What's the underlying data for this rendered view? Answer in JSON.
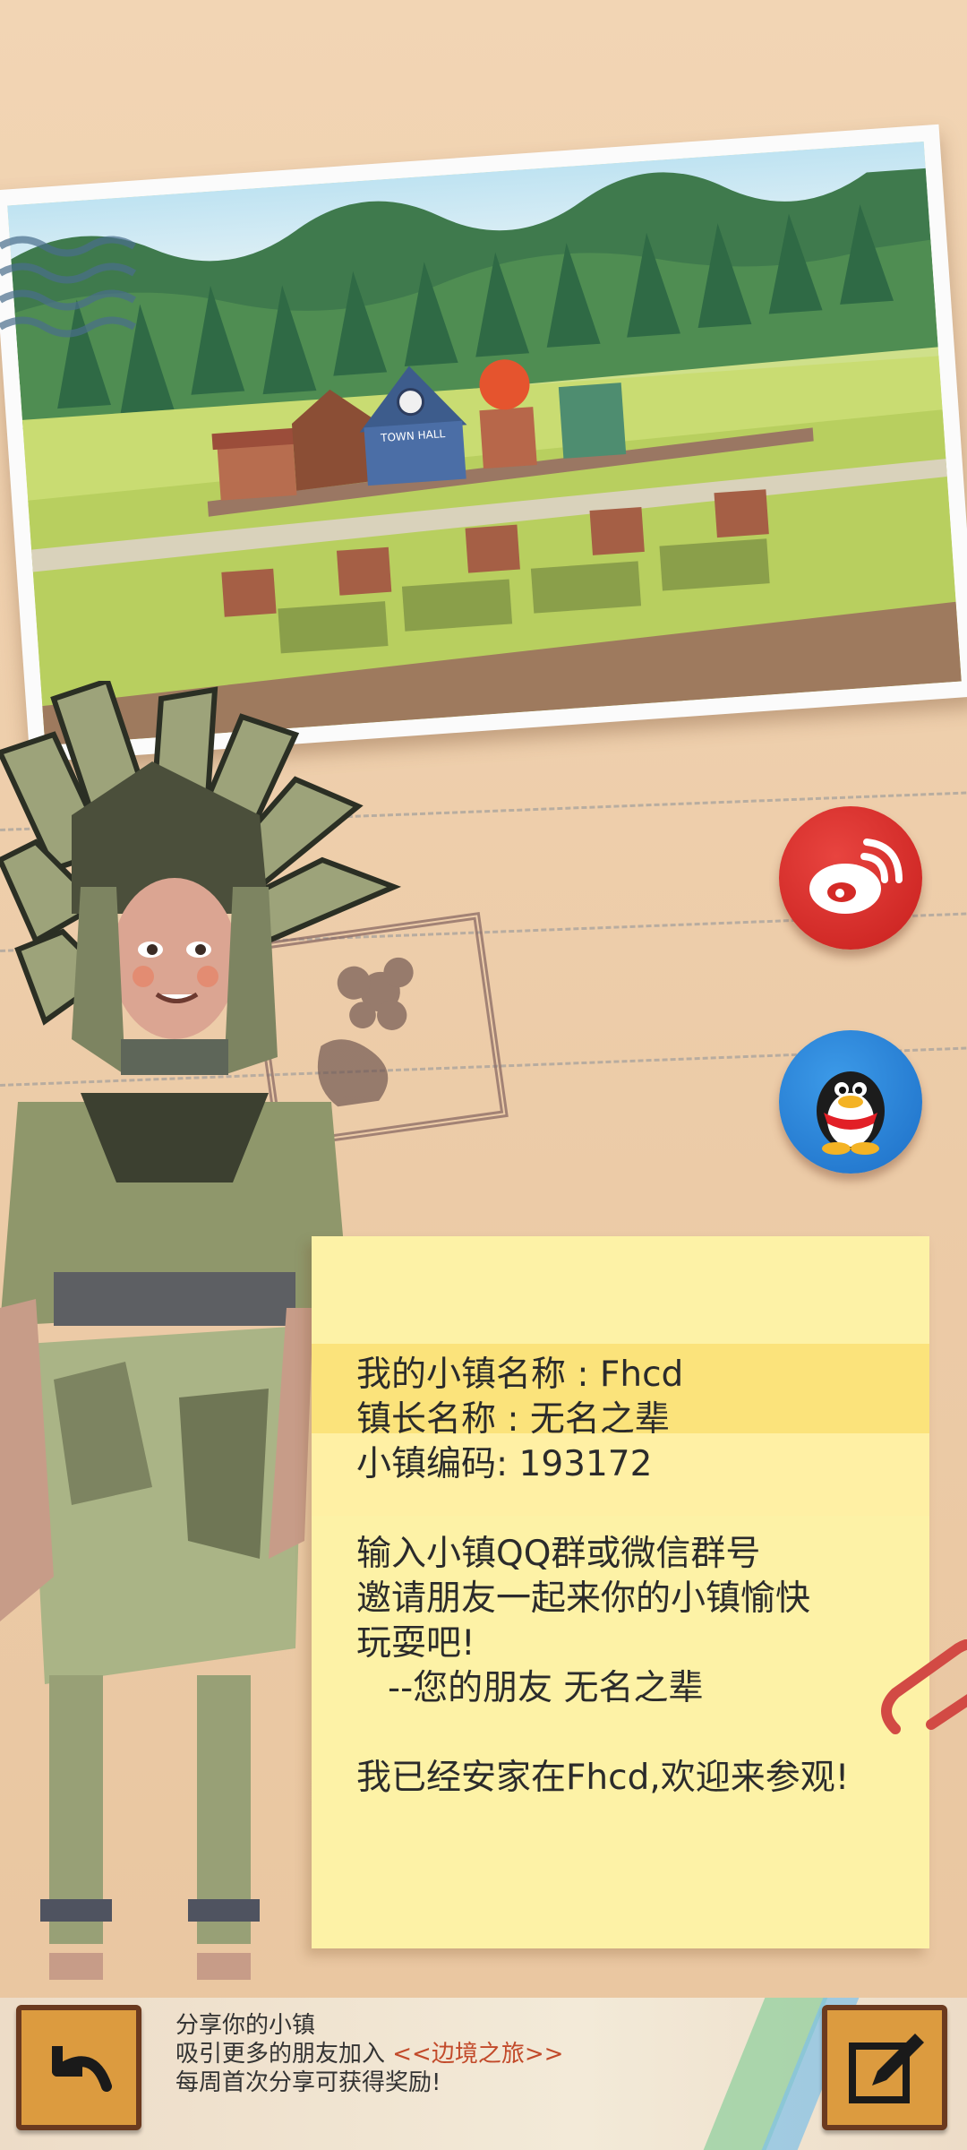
{
  "note": {
    "town_name_line": "我的小镇名称 : Fhcd",
    "mayor_line": "镇长名称 : 无名之辈",
    "town_code_line": "小镇编码: 193172",
    "invite_line1": "输入小镇QQ群或微信群号",
    "invite_line2": "邀请朋友一起来你的小镇愉快",
    "invite_line3": "玩耍吧!",
    "signature_line": "--您的朋友 无名之辈",
    "welcome_line": "我已经安家在Fhcd,欢迎来参观!"
  },
  "share_buttons": [
    {
      "name": "weibo",
      "icon": "weibo-icon",
      "color": "#d42a26"
    },
    {
      "name": "qq",
      "icon": "qq-penguin-icon",
      "color": "#2a86db"
    }
  ],
  "bottom_bar": {
    "line1": "分享你的小镇",
    "line2_prefix": "吸引更多的朋友加入 ",
    "line2_brand": "<<边境之旅>>",
    "line3": "每周首次分享可获得奖励!",
    "back_icon": "back-arrow-icon",
    "edit_icon": "pencil-edit-icon"
  },
  "photo": {
    "town_hall_sign": "TOWN HALL"
  }
}
